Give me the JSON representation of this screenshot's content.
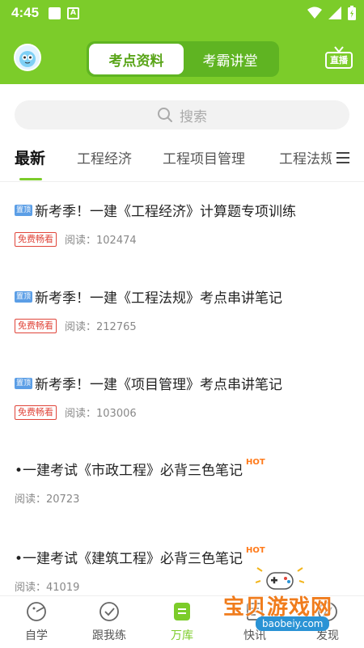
{
  "status": {
    "time": "4:45"
  },
  "header": {
    "tab_active": "考点资料",
    "tab_inactive": "考霸讲堂",
    "live_label": "直播"
  },
  "search": {
    "placeholder": "搜索"
  },
  "tabs": [
    "最新",
    "工程经济",
    "工程项目管理",
    "工程法规"
  ],
  "items": [
    {
      "pin": "置顶",
      "title": "新考季！一建《工程经济》计算题专项训练",
      "badge": "免费畅看",
      "reads": "阅读：102474"
    },
    {
      "pin": "置顶",
      "title": "新考季！一建《工程法规》考点串讲笔记",
      "badge": "免费畅看",
      "reads": "阅读：212765"
    },
    {
      "pin": "置顶",
      "title": "新考季！一建《项目管理》考点串讲笔记",
      "badge": "免费畅看",
      "reads": "阅读：103006"
    },
    {
      "title": "•一建考试《市政工程》必背三色笔记",
      "hot": "HOT",
      "reads": "阅读：20723"
    },
    {
      "title": "•一建考试《建筑工程》必背三色笔记",
      "hot": "HOT",
      "reads": "阅读：41019"
    }
  ],
  "bottom_nav": [
    {
      "label": "自学",
      "icon": "self-study-icon"
    },
    {
      "label": "跟我练",
      "icon": "check-circle-icon"
    },
    {
      "label": "万库",
      "icon": "library-icon"
    },
    {
      "label": "快讯",
      "icon": "news-icon"
    },
    {
      "label": "发现",
      "icon": "discover-icon"
    }
  ],
  "watermark": {
    "text": "宝贝游戏网",
    "url": "baobeiy.com"
  },
  "colors": {
    "brand_green": "#7ccc2a",
    "free_red": "#e0453a",
    "pin_blue": "#5b9ee6",
    "hot_orange": "#ff7a1a"
  }
}
